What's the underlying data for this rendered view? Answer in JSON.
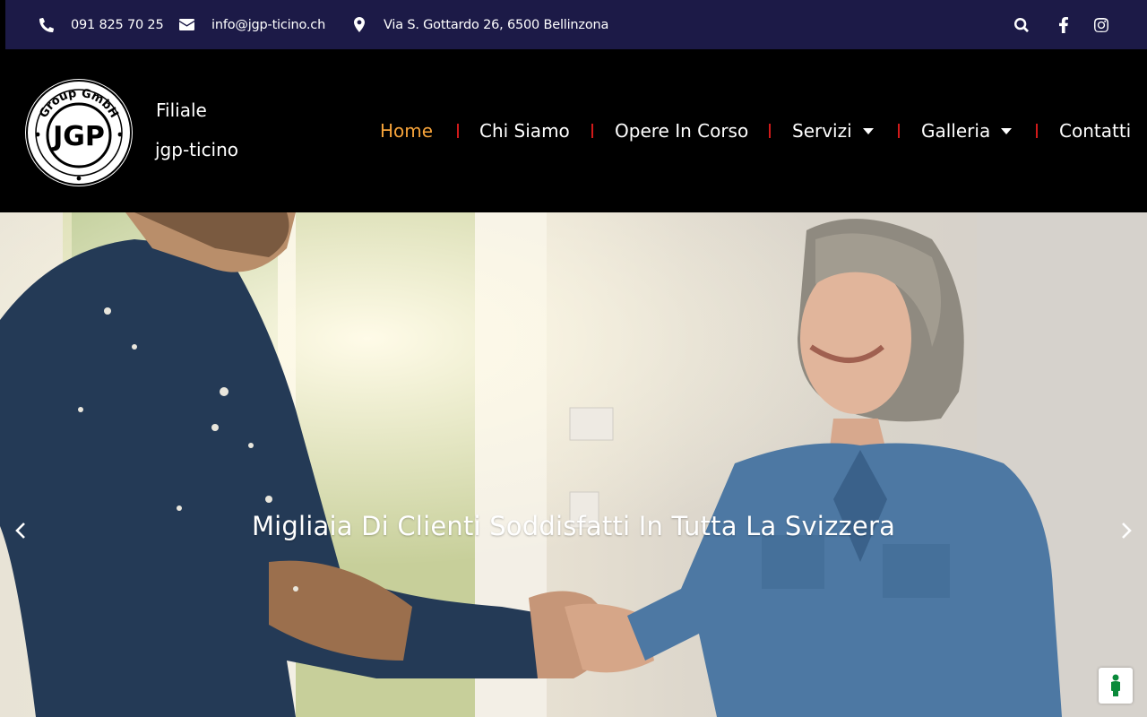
{
  "topbar": {
    "phone": "091 825 70 25",
    "email": "info@jgp-ticino.ch",
    "address": "Via S. Gottardo 26, 6500 Bellinzona",
    "icons": [
      "phone-icon",
      "envelope-icon",
      "map-marker-icon",
      "search-icon",
      "facebook-icon",
      "instagram-icon"
    ]
  },
  "header": {
    "logo": {
      "ring_text": "Group GmbH",
      "initials": "JGP"
    },
    "brand_line1": "Filiale",
    "brand_line2": "jgp-ticino"
  },
  "nav": {
    "items": [
      {
        "label": "Home",
        "active": true,
        "dropdown": false
      },
      {
        "label": "Chi Siamo",
        "active": false,
        "dropdown": false
      },
      {
        "label": "Opere In Corso",
        "active": false,
        "dropdown": false
      },
      {
        "label": "Servizi",
        "active": false,
        "dropdown": true
      },
      {
        "label": "Galleria",
        "active": false,
        "dropdown": true
      },
      {
        "label": "Contatti",
        "active": false,
        "dropdown": false
      }
    ],
    "active_color": "#f6a33a",
    "separator_color": "#d11a1a"
  },
  "hero": {
    "caption": "Migliaia Di Clienti Soddisfatti In Tutta La Svizzera",
    "prev_icon": "chevron-left-icon",
    "next_icon": "chevron-right-icon"
  },
  "accessibility": {
    "icon": "accessibility-icon"
  },
  "colors": {
    "topbar_bg": "#1c1a47",
    "header_bg": "#000000"
  }
}
